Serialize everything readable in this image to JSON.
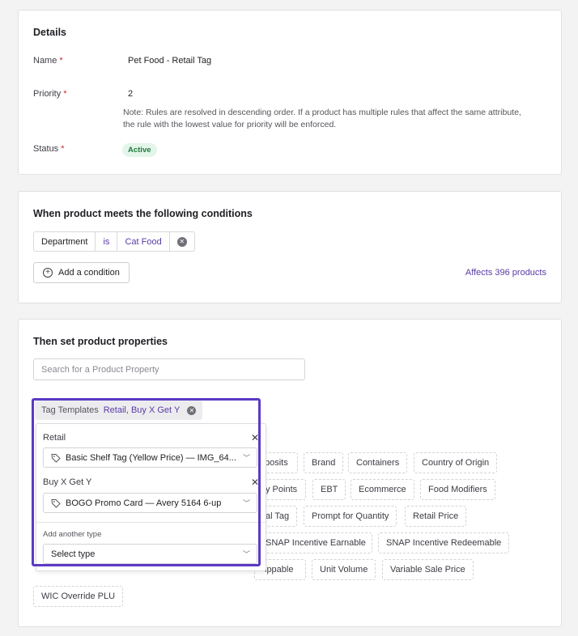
{
  "details": {
    "title": "Details",
    "name_label": "Name",
    "name_value": "Pet Food - Retail Tag",
    "priority_label": "Priority",
    "priority_value": "2",
    "priority_note": "Note: Rules are resolved in descending order. If a product has multiple rules that affect the same attribute, the rule with the lowest value for priority will be enforced.",
    "status_label": "Status",
    "status_value": "Active",
    "required_mark": "*"
  },
  "conditions": {
    "title": "When product meets the following conditions",
    "condition": {
      "field": "Department",
      "operator": "is",
      "value": "Cat Food"
    },
    "add_label": "Add a condition",
    "affects": "Affects 396 products"
  },
  "properties": {
    "title": "Then set product properties",
    "search_placeholder": "Search for a Product Property",
    "tag_templates": {
      "label": "Tag Templates",
      "selected": "Retail, Buy X Get Y"
    },
    "panel": {
      "retail_label": "Retail",
      "retail_value": "Basic Shelf Tag (Yellow Price) — IMG_64...",
      "bogo_label": "Buy X Get Y",
      "bogo_value": "BOGO Promo Card — Avery 5164 6-up",
      "add_type_label": "Add another type",
      "add_type_placeholder": "Select type",
      "close_glyph": "✕"
    },
    "chips": {
      "deposits": "posits",
      "brand": "Brand",
      "containers": "Containers",
      "country": "Country of Origin",
      "loyalty": "y Points",
      "ebt": "EBT",
      "ecommerce": "Ecommerce",
      "food_modifiers": "Food Modifiers",
      "local_tag": "al Tag",
      "prompt_qty": "Prompt for Quantity",
      "retail_price": "Retail Price",
      "snap_earnable": "SNAP Incentive Earnable",
      "snap_redeemable": "SNAP Incentive Redeemable",
      "shippable": "ippable",
      "unit_volume": "Unit Volume",
      "variable_price": "Variable Sale Price",
      "wic": "WIC Override PLU"
    }
  },
  "colors": {
    "accent": "#5a3aa6",
    "highlight": "#5b3ac4",
    "active_badge_bg": "#e4f5e9",
    "active_badge_text": "#1f7a3d"
  }
}
